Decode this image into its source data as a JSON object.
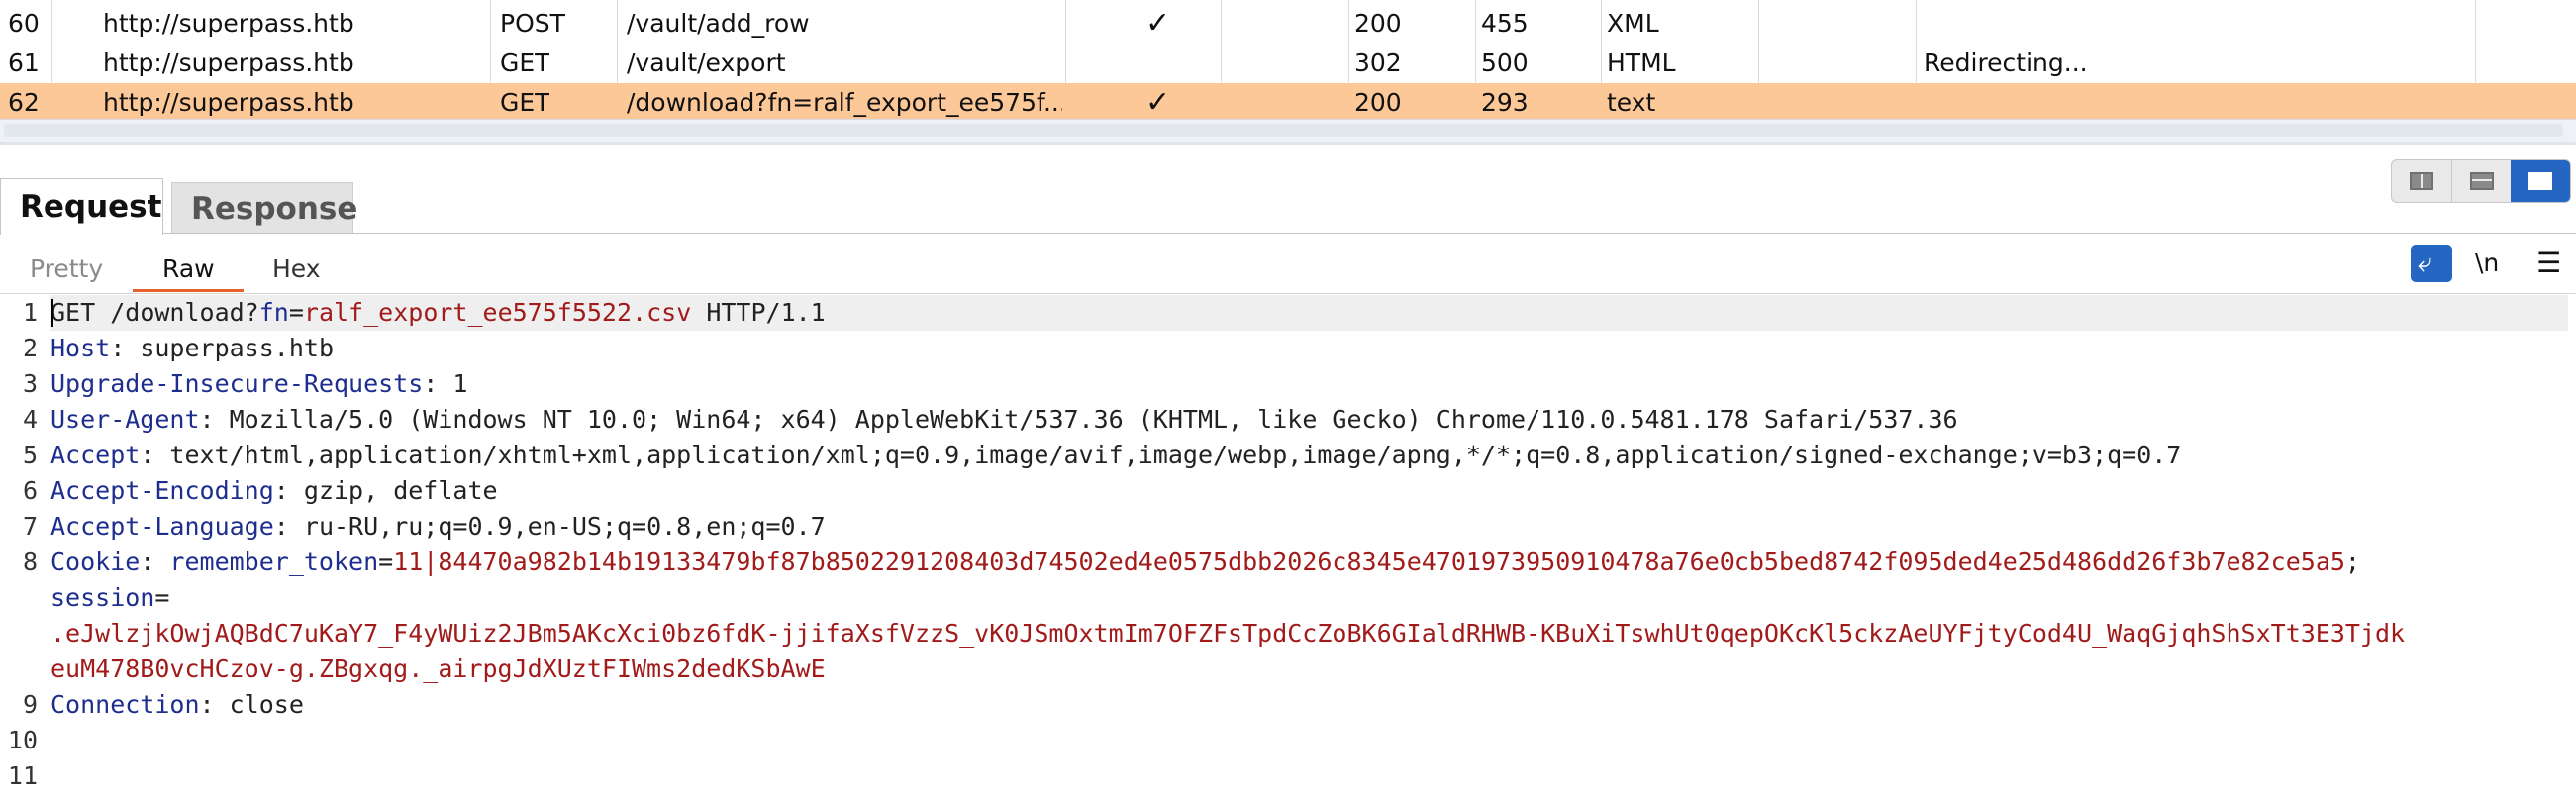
{
  "history": {
    "rows": [
      {
        "id": "60",
        "host": "http://superpass.htb",
        "method": "POST",
        "url": "/vault/add_row",
        "params": "✓",
        "status": "200",
        "length": "455",
        "mime": "XML",
        "title": "",
        "selected": false
      },
      {
        "id": "61",
        "host": "http://superpass.htb",
        "method": "GET",
        "url": "/vault/export",
        "params": "",
        "status": "302",
        "length": "500",
        "mime": "HTML",
        "title": "Redirecting...",
        "selected": false
      },
      {
        "id": "62",
        "host": "http://superpass.htb",
        "method": "GET",
        "url": "/download?fn=ralf_export_ee575f...",
        "params": "✓",
        "status": "200",
        "length": "293",
        "mime": "text",
        "title": "",
        "selected": true
      }
    ],
    "selected_color": "#fdc898"
  },
  "tabs": {
    "request": "Request",
    "response": "Response"
  },
  "subtabs": {
    "pretty": "Pretty",
    "raw": "Raw",
    "hex": "Hex"
  },
  "toolbar": {
    "wrap_icon": "word-wrap-icon",
    "newline": "\\n",
    "menu": "☰"
  },
  "request": {
    "line_numbers": [
      "1",
      "2",
      "3",
      "4",
      "5",
      "6",
      "7",
      "8",
      "",
      "",
      "",
      "9",
      "10",
      "11"
    ],
    "request_line": {
      "method": "GET",
      "path": "/download?",
      "param": "fn",
      "value": "ralf_export_ee575f5522.csv",
      "version": "HTTP/1.1"
    },
    "headers": [
      {
        "name": "Host",
        "value": "superpass.htb"
      },
      {
        "name": "Upgrade-Insecure-Requests",
        "value": "1"
      },
      {
        "name": "User-Agent",
        "value": "Mozilla/5.0 (Windows NT 10.0; Win64; x64) AppleWebKit/537.36 (KHTML, like Gecko) Chrome/110.0.5481.178 Safari/537.36"
      },
      {
        "name": "Accept",
        "value": "text/html,application/xhtml+xml,application/xml;q=0.9,image/avif,image/webp,image/apng,*/*;q=0.8,application/signed-exchange;v=b3;q=0.7"
      },
      {
        "name": "Accept-Encoding",
        "value": "gzip, deflate"
      },
      {
        "name": "Accept-Language",
        "value": "ru-RU,ru;q=0.9,en-US;q=0.8,en;q=0.7"
      }
    ],
    "cookie": {
      "name": "Cookie",
      "remember_name": "remember_token",
      "remember_value": "11|84470a982b14b19133479bf87b8502291208403d74502ed4e0575dbb2026c8345e4701973950910478a76e0cb5bed8742f095ded4e25d486dd26f3b7e82ce5a5",
      "session_name": "session",
      "session_value_1": ".eJwlzjkOwjAQBdC7uKaY7_F4yWUiz2JBm5AKcXci0bz6fdK-jjifaXsfVzzS_vK0JSmOxtmIm7OFZFsTpdCcZoBK6GIaldRHWB-KBuXiTswhUt0qepOKcKl5ckzAeUYFjtyCod4U_WaqGjqhShSxTt3E3Tjdk",
      "session_value_2": "euM478B0vcHCzov-g.ZBgxqg._airpgJdXUztFIWms2dedKSbAwE"
    },
    "connection": {
      "name": "Connection",
      "value": "close"
    }
  }
}
